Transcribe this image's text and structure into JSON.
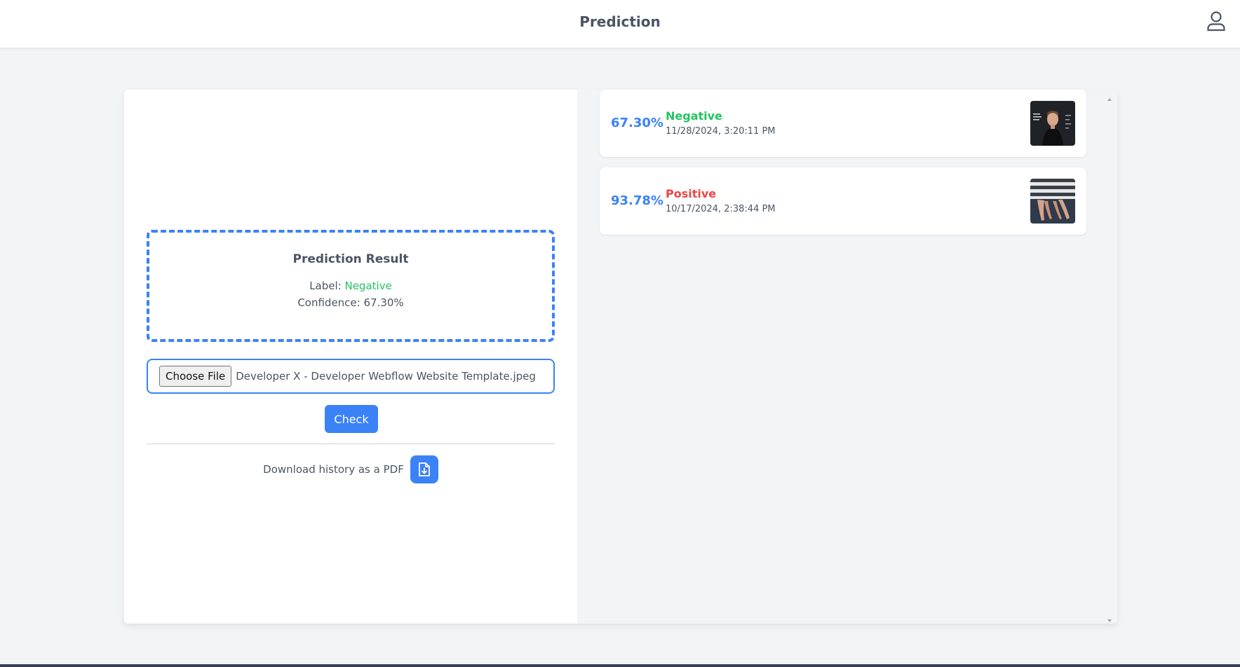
{
  "header": {
    "title": "Prediction",
    "user_icon": "user-icon"
  },
  "result": {
    "title": "Prediction Result",
    "label_prefix": "Label: ",
    "label_value": "Negative",
    "confidence_text": "Confidence: 67.30%"
  },
  "upload": {
    "choose_label": "Choose File",
    "file_name": "Developer X - Developer Webflow Website Template.jpeg",
    "check_label": "Check"
  },
  "download": {
    "text": "Download history as a PDF",
    "icon": "file-download-icon"
  },
  "history": [
    {
      "confidence": "67.30%",
      "label": "Negative",
      "date": "11/28/2024, 3:20:11 PM",
      "color": "#22c55e"
    },
    {
      "confidence": "93.78%",
      "label": "Positive",
      "date": "10/17/2024, 2:38:44 PM",
      "color": "#ef4444"
    }
  ],
  "colors": {
    "accent": "#3b82f6",
    "negative": "#22c55e",
    "positive": "#ef4444"
  }
}
